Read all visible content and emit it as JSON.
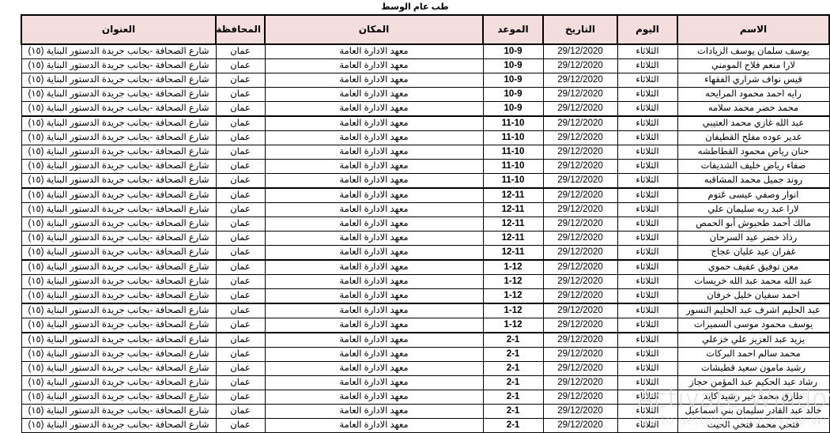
{
  "title": "طب عام  الوسط",
  "table": {
    "columns": [
      {
        "key": "name",
        "label": "الاسم"
      },
      {
        "key": "day",
        "label": "اليوم"
      },
      {
        "key": "date",
        "label": "التاريخ"
      },
      {
        "key": "time",
        "label": "الموعد"
      },
      {
        "key": "place",
        "label": "المكان"
      },
      {
        "key": "gov",
        "label": "المحافظة"
      },
      {
        "key": "address",
        "label": "العنوان"
      }
    ],
    "header_bg": "#f3dddd",
    "border_color": "#000000",
    "rows": [
      {
        "name": "يوسف سلمان يوسف الزيادات",
        "day": "الثلاثاء",
        "date": "29/12/2020",
        "time": "10-9",
        "place": "معهد الادارة العامة",
        "gov": "عمان",
        "address": "شارع الصحافة -بجانب جريدة الدستور البناية (١٥)",
        "group_start": true
      },
      {
        "name": "لارا منعم فلاح المومني",
        "day": "الثلاثاء",
        "date": "29/12/2020",
        "time": "10-9",
        "place": "معهد الادارة العامة",
        "gov": "عمان",
        "address": "شارع الصحافة -بجانب جريدة الدستور البناية (١٥)",
        "group_start": false
      },
      {
        "name": "قيس نواف شراري الفقهاء",
        "day": "الثلاثاء",
        "date": "29/12/2020",
        "time": "10-9",
        "place": "معهد الادارة العامة",
        "gov": "عمان",
        "address": "شارع الصحافة -بجانب جريدة الدستور البناية (١٥)",
        "group_start": false
      },
      {
        "name": "رايه احمد محمود المرايحه",
        "day": "الثلاثاء",
        "date": "29/12/2020",
        "time": "10-9",
        "place": "معهد الادارة العامة",
        "gov": "عمان",
        "address": "شارع الصحافة -بجانب جريدة الدستور البناية (١٥)",
        "group_start": false
      },
      {
        "name": "محمد خضر محمد سلامه",
        "day": "الثلاثاء",
        "date": "29/12/2020",
        "time": "10-9",
        "place": "معهد الادارة العامة",
        "gov": "عمان",
        "address": "شارع الصحافة -بجانب جريدة الدستور البناية (١٥)",
        "group_start": false
      },
      {
        "name": "عبد الله غازي محمد العتيبي",
        "day": "الثلاثاء",
        "date": "29/12/2020",
        "time": "11-10",
        "place": "معهد الادارة العامة",
        "gov": "عمان",
        "address": "شارع الصحافة -بجانب جريدة الدستور البناية (١٥)",
        "group_start": true
      },
      {
        "name": "غدير عوده مفلح القطيفان",
        "day": "الثلاثاء",
        "date": "29/12/2020",
        "time": "11-10",
        "place": "معهد الادارة العامة",
        "gov": "عمان",
        "address": "شارع الصحافة -بجانب جريدة الدستور البناية (١٥)",
        "group_start": false
      },
      {
        "name": "حنان رياض محمود القطاطشه",
        "day": "الثلاثاء",
        "date": "29/12/2020",
        "time": "11-10",
        "place": "معهد الادارة العامة",
        "gov": "عمان",
        "address": "شارع الصحافة -بجانب جريدة الدستور البناية (١٥)",
        "group_start": false
      },
      {
        "name": "صفاء رياض خليف الشديفات",
        "day": "الثلاثاء",
        "date": "29/12/2020",
        "time": "11-10",
        "place": "معهد الادارة العامة",
        "gov": "عمان",
        "address": "شارع الصحافة -بجانب جريدة الدستور البناية (١٥)",
        "group_start": false
      },
      {
        "name": "روند جميل محمد المشاقبه",
        "day": "الثلاثاء",
        "date": "29/12/2020",
        "time": "11-10",
        "place": "معهد الادارة العامة",
        "gov": "عمان",
        "address": "شارع الصحافة -بجانب جريدة الدستور البناية (١٥)",
        "group_start": false
      },
      {
        "name": "انوار وصفي عيسى عَتوم",
        "day": "الثلاثاء",
        "date": "29/12/2020",
        "time": "12-11",
        "place": "معهد الادارة العامة",
        "gov": "عمان",
        "address": "شارع الصحافة -بجانب جريدة الدستور البناية (١٥)",
        "group_start": true
      },
      {
        "name": "لارا عبد ربه سليمان علي",
        "day": "الثلاثاء",
        "date": "29/12/2020",
        "time": "12-11",
        "place": "معهد الادارة العامة",
        "gov": "عمان",
        "address": "شارع الصحافة -بجانب جريدة الدستور البناية (١٥)",
        "group_start": false
      },
      {
        "name": "مالك أحمد طحبوش أبو الحمص",
        "day": "الثلاثاء",
        "date": "29/12/2020",
        "time": "12-11",
        "place": "معهد الادارة العامة",
        "gov": "عمان",
        "address": "شارع الصحافة -بجانب جريدة الدستور البناية (١٥)",
        "group_start": false
      },
      {
        "name": "رذاذ خضر عيد السرحان",
        "day": "الثلاثاء",
        "date": "29/12/2020",
        "time": "12-11",
        "place": "معهد الادارة العامة",
        "gov": "عمان",
        "address": "شارع الصحافة -بجانب جريدة الدستور البناية (١٥)",
        "group_start": false
      },
      {
        "name": "غفران عيد عليان عجاج",
        "day": "الثلاثاء",
        "date": "29/12/2020",
        "time": "12-11",
        "place": "معهد الادارة العامة",
        "gov": "عمان",
        "address": "شارع الصحافة -بجانب جريدة الدستور البناية (١٥)",
        "group_start": false
      },
      {
        "name": "معن توفيق عفيف حموي",
        "day": "الثلاثاء",
        "date": "29/12/2020",
        "time": "1-12",
        "place": "معهد الادارة العامة",
        "gov": "عمان",
        "address": "شارع الصحافة -بجانب جريدة الدستور البناية (١٥)",
        "group_start": true
      },
      {
        "name": "عبد الله محمد عبد الله خريسات",
        "day": "الثلاثاء",
        "date": "29/12/2020",
        "time": "1-12",
        "place": "معهد الادارة العامة",
        "gov": "عمان",
        "address": "شارع الصحافة -بجانب جريدة الدستور البناية (١٥)",
        "group_start": false
      },
      {
        "name": "احمد سفيان خليل خرفان",
        "day": "الثلاثاء",
        "date": "29/12/2020",
        "time": "1-12",
        "place": "معهد الادارة العامة",
        "gov": "عمان",
        "address": "شارع الصحافة -بجانب جريدة الدستور البناية (١٥)",
        "group_start": false
      },
      {
        "name": "عبد الحليم اشرف عبد الحليم النسور",
        "day": "الثلاثاء",
        "date": "29/12/2020",
        "time": "1-12",
        "place": "معهد الادارة العامة",
        "gov": "عمان",
        "address": "شارع الصحافة -بجانب جريدة الدستور البناية (١٥)",
        "group_start": true
      },
      {
        "name": "يوسف محمود موسى السميرات",
        "day": "الثلاثاء",
        "date": "29/12/2020",
        "time": "1-12",
        "place": "معهد الادارة العامة",
        "gov": "عمان",
        "address": "شارع الصحافة -بجانب جريدة الدستور البناية (١٥)",
        "group_start": false
      },
      {
        "name": "يزيد عبد العزيز علي خزعلي",
        "day": "الثلاثاء",
        "date": "29/12/2020",
        "time": "2-1",
        "place": "معهد الادارة العامة",
        "gov": "عمان",
        "address": "شارع الصحافة -بجانب جريدة الدستور البناية (١٥)",
        "group_start": true
      },
      {
        "name": "محمد سالم احمد البركات",
        "day": "الثلاثاء",
        "date": "29/12/2020",
        "time": "2-1",
        "place": "معهد الادارة العامة",
        "gov": "عمان",
        "address": "شارع الصحافة -بجانب جريدة الدستور البناية (١٥)",
        "group_start": false
      },
      {
        "name": "رشيد مامون سعيد قطيشات",
        "day": "الثلاثاء",
        "date": "29/12/2020",
        "time": "2-1",
        "place": "معهد الادارة العامة",
        "gov": "عمان",
        "address": "شارع الصحافة -بجانب جريدة الدستور البناية (١٥)",
        "group_start": false
      },
      {
        "name": "رشاد عبد الحكيم عبد المؤمن حجاز",
        "day": "الثلاثاء",
        "date": "29/12/2020",
        "time": "2-1",
        "place": "معهد الادارة العامة",
        "gov": "عمان",
        "address": "شارع الصحافة -بجانب جريدة الدستور البناية (١٥)",
        "group_start": false
      },
      {
        "name": "طارق محمد خير رشيد كايد",
        "day": "الثلاثاء",
        "date": "29/12/2020",
        "time": "2-1",
        "place": "معهد الادارة العامة",
        "gov": "عمان",
        "address": "شارع الصحافة -بجانب جريدة الدستور البناية (١٥)",
        "group_start": false
      },
      {
        "name": "خالد عبد القادر سليمان بني اسماعيل",
        "day": "الثلاثاء",
        "date": "29/12/2020",
        "time": "2-1",
        "place": "معهد الادارة العامة",
        "gov": "عمان",
        "address": "شارع الصحافة -بجانب جريدة الدستور البناية (١٥)",
        "group_start": false
      },
      {
        "name": "فتحي محمد فتحي الحيت",
        "day": "الثلاثاء",
        "date": "29/12/2020",
        "time": "2-1",
        "place": "معهد الادارة العامة",
        "gov": "عمان",
        "address": "شارع الصحافة -بجانب جريدة الدستور البناية (١٥)",
        "group_start": false
      }
    ]
  },
  "watermark": {
    "line1": "Activate Windows",
    "line2": "Go to Settings to activate Wind",
    "color": "#d9d9d9"
  }
}
